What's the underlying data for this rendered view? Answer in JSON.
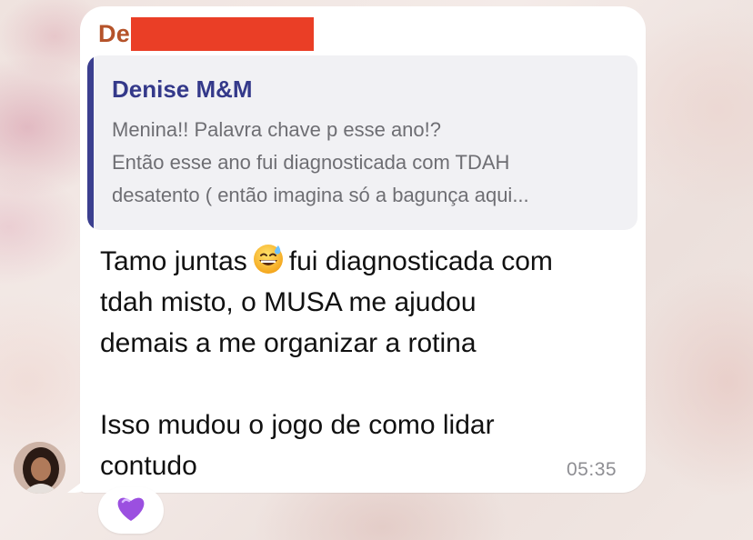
{
  "chat": {
    "sender_visible": "De",
    "quote": {
      "author": "Denise M&M",
      "lines": [
        "Menina!! Palavra chave p esse ano!?",
        "Então esse ano fui diagnosticada com TDAH",
        "desatento ( então imagina só a bagunça aqui..."
      ]
    },
    "message": {
      "line1_before_emoji": "Tamo juntas",
      "line1_emoji": "grinning-sweat-emoji",
      "line1_after_emoji": "fui diagnosticada com",
      "line2": "tdah misto, o MUSA me ajudou",
      "line3": "demais a me organizar a rotina",
      "line4": "",
      "line5": "Isso mudou o jogo de como lidar",
      "line6": "contudo"
    },
    "timestamp": "05:35",
    "reaction": {
      "icon": "purple-heart-icon",
      "color": "#9b4fe0"
    }
  },
  "colors": {
    "sender_name": "#b5532a",
    "redaction": "#ea3e26",
    "quote_accent": "#34398a",
    "bubble": "#ffffff"
  }
}
